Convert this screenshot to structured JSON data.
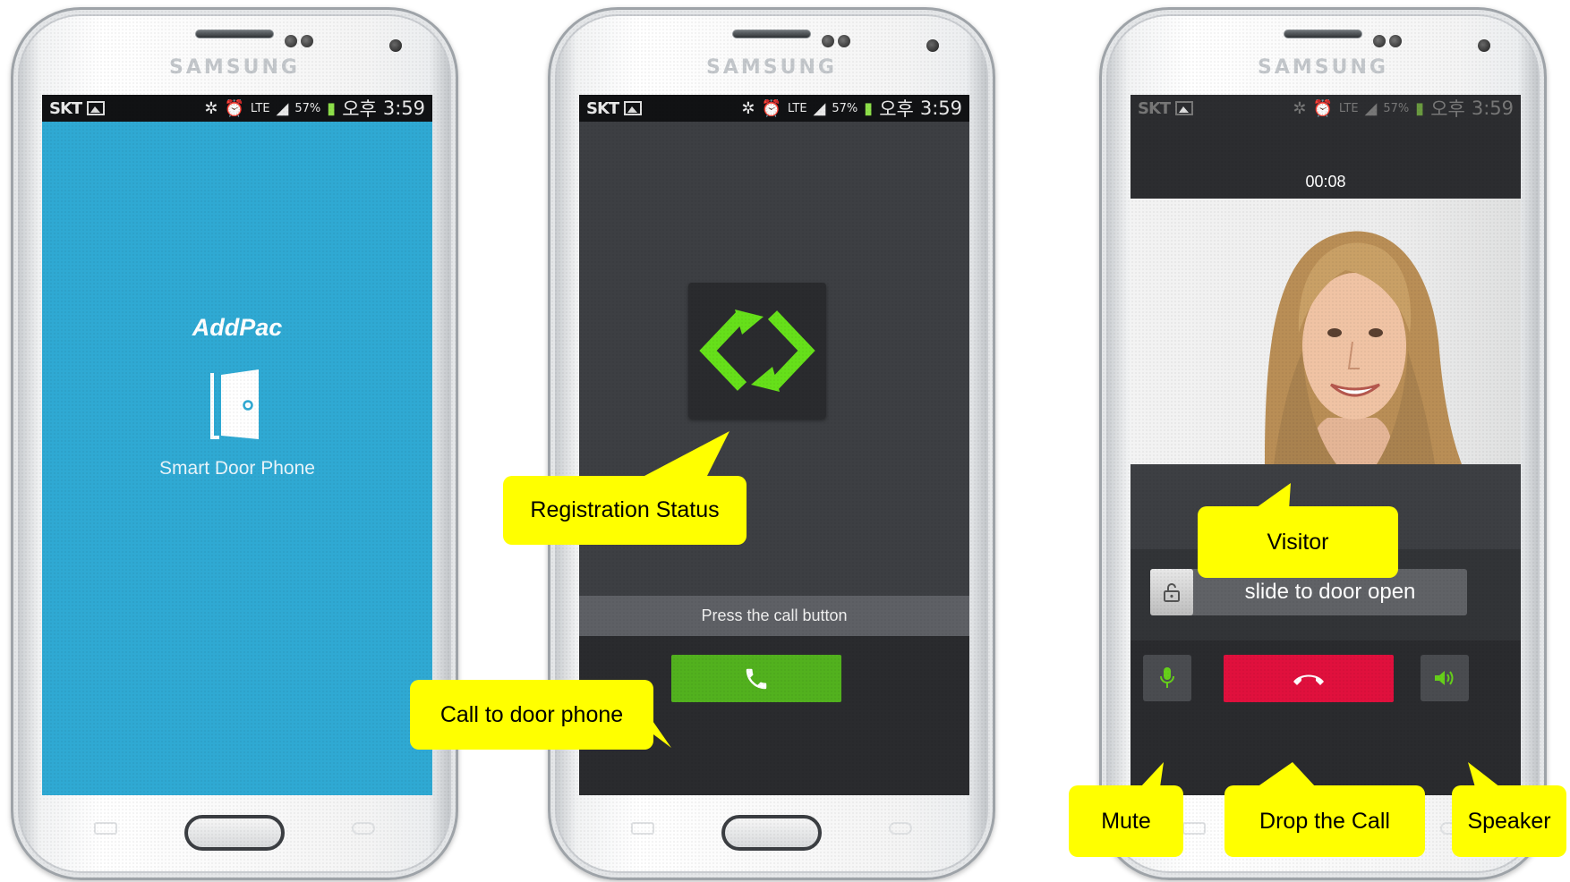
{
  "status_bar": {
    "carrier": "SKT",
    "lte": "LTE",
    "battery": "57%",
    "ampm": "오후",
    "time": "3:59"
  },
  "phone_brand": "SAMSUNG",
  "screen1": {
    "logo": "AddPac",
    "app_title": "Smart Door Phone",
    "background": "#2fa9d3"
  },
  "screen2": {
    "prompt": "Press the call button",
    "call_button_color": "#52b11e",
    "reg_icon_color": "#66e01a"
  },
  "screen3": {
    "call_timer": "00:08",
    "slide_label": "slide to door open",
    "drop_button_color": "#e0103d"
  },
  "callouts": {
    "registration_status": "Registration Status",
    "call_to_door_phone": "Call to door phone",
    "visitor": "Visitor",
    "mute": "Mute",
    "drop_the_call": "Drop the Call",
    "speaker": "Speaker"
  },
  "callout_color": "#ffff00"
}
